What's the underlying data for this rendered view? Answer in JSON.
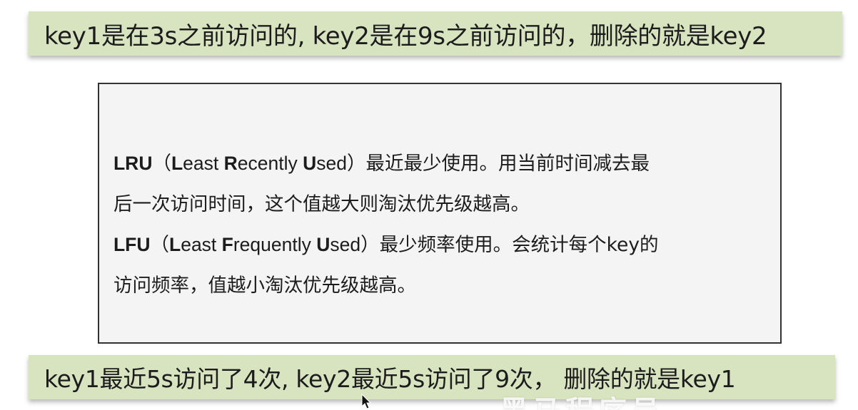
{
  "top_banner": {
    "text": "key1是在3s之前访问的, key2是在9s之前访问的，删除的就是key2"
  },
  "card": {
    "lru": {
      "abbr": "LRU",
      "open_paren": "（",
      "w1_initial": "L",
      "w1_rest": "east ",
      "w2_initial": "R",
      "w2_rest": "ecently ",
      "w3_initial": "U",
      "w3_rest": "sed",
      "close_paren": "）",
      "desc_line1": "最近最少使用。用当前时间减去最",
      "desc_line2": "后一次访问时间，这个值越大则淘汰优先级越高。"
    },
    "lfu": {
      "abbr": "LFU",
      "open_paren": "（",
      "w1_initial": "L",
      "w1_rest": "east ",
      "w2_initial": "F",
      "w2_rest": "requently ",
      "w3_initial": "U",
      "w3_rest": "sed",
      "close_paren": "）",
      "desc_line1": "最少频率使用。会统计每个key的",
      "desc_line2": "访问频率，值越小淘汰优先级越高。"
    }
  },
  "bottom_banner": {
    "text": "key1最近5s访问了4次, key2最近5s访问了9次，  删除的就是key1"
  },
  "watermark": {
    "text": "黑马程序员"
  },
  "colors": {
    "banner_bg": "#d8e3c0",
    "card_bg": "#f4f4f4",
    "card_border": "#333333",
    "text": "#1c1c1c"
  }
}
